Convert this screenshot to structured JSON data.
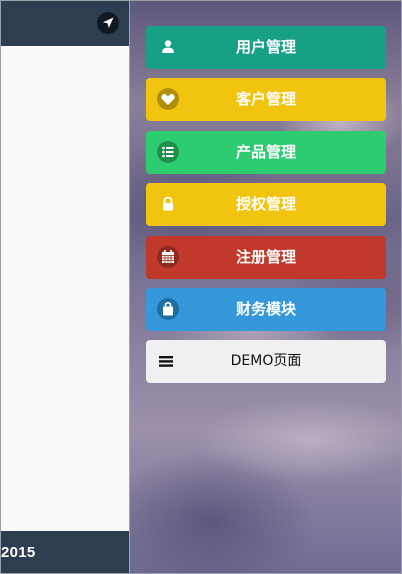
{
  "left_page": {
    "footer_text": "2015",
    "header_icon": "location-arrow-icon"
  },
  "menu": {
    "items": [
      {
        "label": "用户管理",
        "icon": "user-icon",
        "color": "#16a085"
      },
      {
        "label": "客户管理",
        "icon": "heart-icon",
        "color": "#f1c40f"
      },
      {
        "label": "产品管理",
        "icon": "list-icon",
        "color": "#2ecc71"
      },
      {
        "label": "授权管理",
        "icon": "lock-icon",
        "color": "#f1c40f"
      },
      {
        "label": "注册管理",
        "icon": "calendar-icon",
        "color": "#c0392b"
      },
      {
        "label": "财务模块",
        "icon": "shopping-bag-icon",
        "color": "#3498db"
      },
      {
        "label": "DEMO页面",
        "icon": "menu-icon",
        "color": "#f0f0f0"
      }
    ]
  }
}
